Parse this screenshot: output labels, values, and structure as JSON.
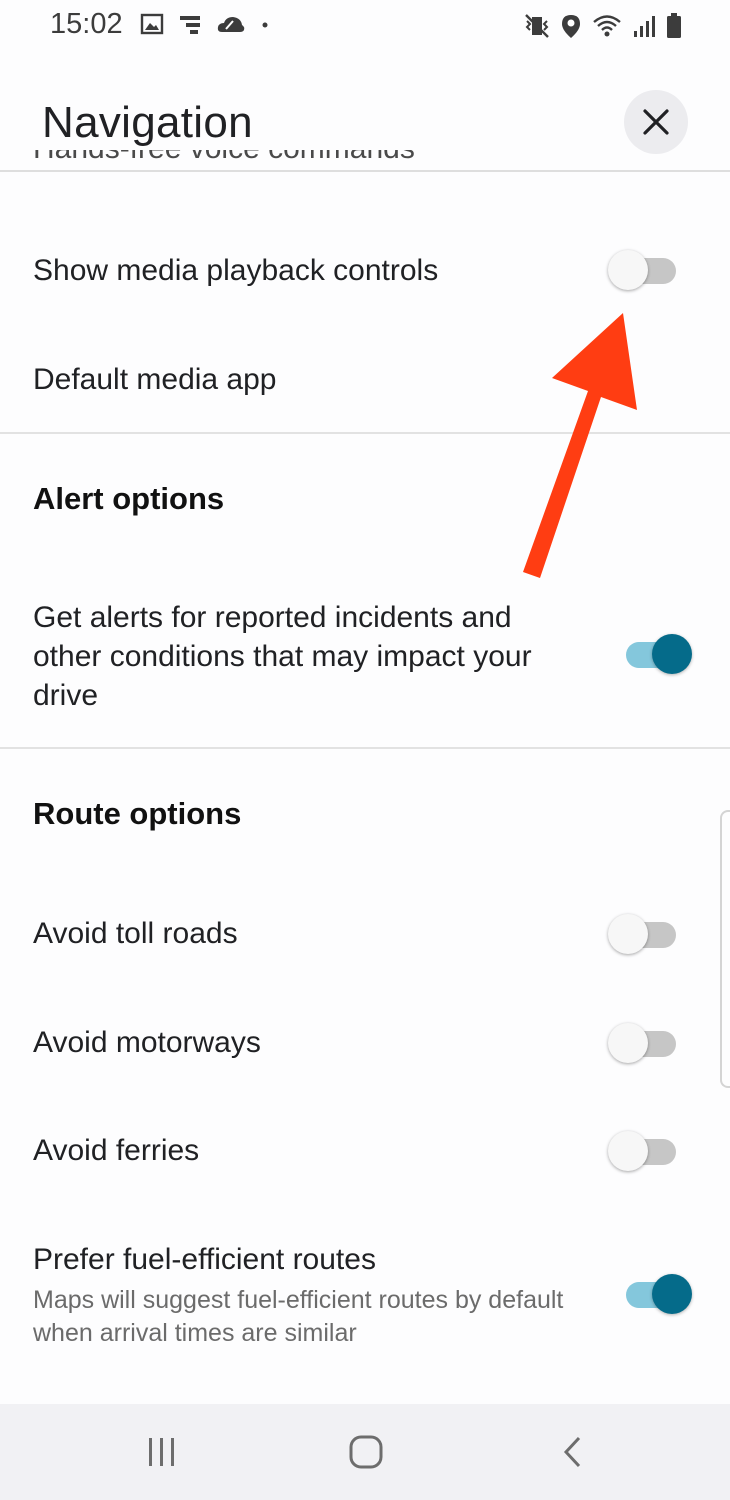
{
  "status_bar": {
    "time": "15:02",
    "left_icons": [
      "image-icon",
      "cast-icon",
      "cloud-icon",
      "dot-icon"
    ],
    "right_icons": [
      "vibrate-mute-icon",
      "location-icon",
      "wifi-icon",
      "signal-icon",
      "battery-icon"
    ]
  },
  "app_bar": {
    "title": "Navigation",
    "close_icon": "close-icon"
  },
  "cut_off_item": "Hands-free voice commands",
  "media": {
    "show_playback_label": "Show media playback controls",
    "show_playback_on": false,
    "default_app_label": "Default media app"
  },
  "alerts": {
    "heading": "Alert options",
    "incidents_label": "Get alerts for reported incidents and other conditions that may impact your drive",
    "incidents_on": true
  },
  "routes": {
    "heading": "Route options",
    "items": [
      {
        "label": "Avoid toll roads",
        "on": false
      },
      {
        "label": "Avoid motorways",
        "on": false
      },
      {
        "label": "Avoid ferries",
        "on": false
      },
      {
        "label": "Prefer fuel-efficient routes",
        "subtext": "Maps will suggest fuel-efficient routes by default when arrival times are similar",
        "on": true
      }
    ]
  },
  "annotation": {
    "arrow_color": "#ff3d12"
  },
  "colors": {
    "toggle_on_knob": "#056b8a",
    "toggle_on_track": "#84c7dc",
    "toggle_off_track": "#c6c6c6"
  },
  "nav_bar": {
    "icons": [
      "recents-icon",
      "home-icon",
      "back-icon"
    ]
  }
}
